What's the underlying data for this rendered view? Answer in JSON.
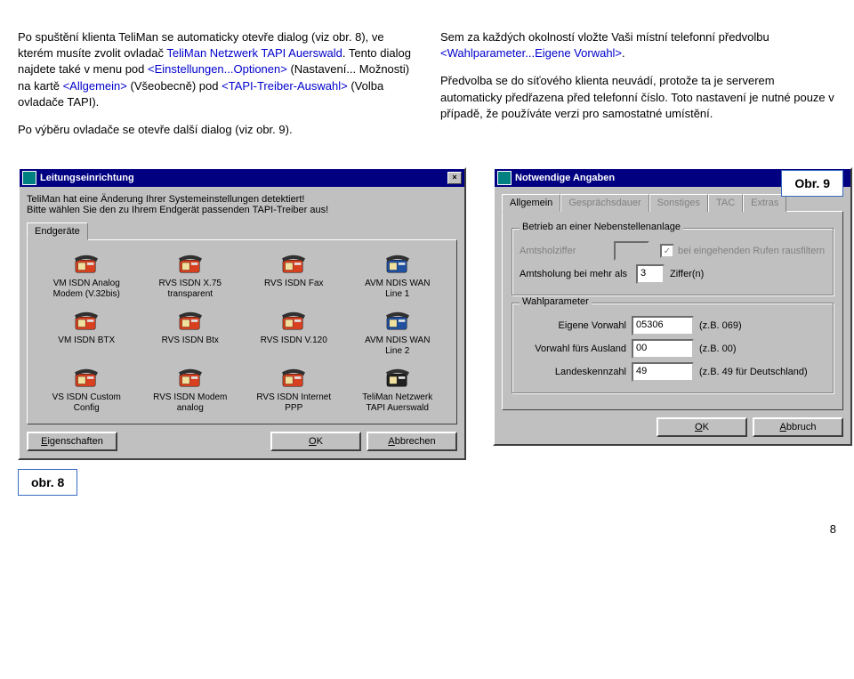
{
  "text_left": {
    "p1a": "Po spuštění klienta TeliMan se automaticky otevře dialog (viz obr. 8), ve kterém musíte zvolit ovladač ",
    "p1b": "TeliMan Netzwerk TAPI Auerswald",
    "p1c": ". Tento dialog najdete také v menu pod ",
    "p1d": "<Einstellungen...Optionen>",
    "p1e": " (Nastavení... Možnosti) na kartě ",
    "p1f": "<Allgemein>",
    "p1g": " (Všeobecně) pod ",
    "p1h": "<TAPI-Treiber-Auswahl>",
    "p1i": " (Volba ovladače TAPI).",
    "p2": "Po výběru ovladače se otevře další dialog (viz obr. 9)."
  },
  "text_right": {
    "p1a": "Sem za každých okolností vložte Vaši místní telefonní předvolbu ",
    "p1b": "<Wahlparameter...Eigene Vorwahl>",
    "p1c": ".",
    "p2": "Předvolba se do síťového klienta neuvádí, protože ta je serverem automaticky předřazena před telefonní číslo. Toto nastavení je nutné pouze v případě, že používáte verzi pro samostatné umístění."
  },
  "leit": {
    "title": "Leitungseinrichtung",
    "intro1": "TeliMan hat eine Änderung Ihrer Systemeinstellungen detektiert!",
    "intro2": "Bitte wählen Sie den zu Ihrem Endgerät passenden TAPI-Treiber aus!",
    "tab": "Endgeräte",
    "items": [
      {
        "label1": "VM ISDN Analog",
        "label2": "Modem (V.32bis)",
        "color": "red"
      },
      {
        "label1": "RVS ISDN X.75",
        "label2": "transparent",
        "color": "red"
      },
      {
        "label1": "RVS ISDN Fax",
        "label2": "",
        "color": "red"
      },
      {
        "label1": "AVM NDIS WAN",
        "label2": "Line 1",
        "color": "blue"
      },
      {
        "label1": "VM ISDN BTX",
        "label2": "",
        "color": "red"
      },
      {
        "label1": "RVS ISDN Btx",
        "label2": "",
        "color": "red"
      },
      {
        "label1": "RVS ISDN V.120",
        "label2": "",
        "color": "red"
      },
      {
        "label1": "AVM NDIS WAN",
        "label2": "Line 2",
        "color": "blue"
      },
      {
        "label1": "VS ISDN Custom",
        "label2": "Config",
        "color": "red"
      },
      {
        "label1": "RVS ISDN Modem",
        "label2": "analog",
        "color": "red"
      },
      {
        "label1": "RVS ISDN Internet",
        "label2": "PPP",
        "color": "red"
      },
      {
        "label1": "TeliMan Netzwerk",
        "label2": "TAPI Auerswald",
        "color": "black"
      }
    ],
    "btn_eig": "Eigenschaften",
    "btn_ok": "OK",
    "btn_cancel": "Abbrechen"
  },
  "notw": {
    "title": "Notwendige Angaben",
    "tabs": [
      "Allgemein",
      "Gesprächsdauer",
      "Sonstiges",
      "TAC",
      "Extras"
    ],
    "group_betrieb": "Betrieb an einer Nebenstellenanlage",
    "amtsholziffer": "Amtsholziffer",
    "bei_eingehenden": "bei eingehenden Rufen rausfiltern",
    "amtsholung_label": "Amtsholung bei mehr als",
    "amtsholung_value": "3",
    "ziffern": "Ziffer(n)",
    "group_wahl": "Wahlparameter",
    "eigene_vorwahl_label": "Eigene Vorwahl",
    "eigene_vorwahl_value": "05306",
    "eigene_vorwahl_hint": "(z.B. 069)",
    "vorwahl_ausland_label": "Vorwahl fürs Ausland",
    "vorwahl_ausland_value": "00",
    "vorwahl_ausland_hint": "(z.B. 00)",
    "landeskennzahl_label": "Landeskennzahl",
    "landeskennzahl_value": "49",
    "landeskennzahl_hint": "(z.B. 49 für Deutschland)",
    "btn_ok": "OK",
    "btn_abbruch": "Abbruch"
  },
  "captions": {
    "obr8": "obr. 8",
    "obr9": "Obr. 9"
  },
  "page": "8"
}
